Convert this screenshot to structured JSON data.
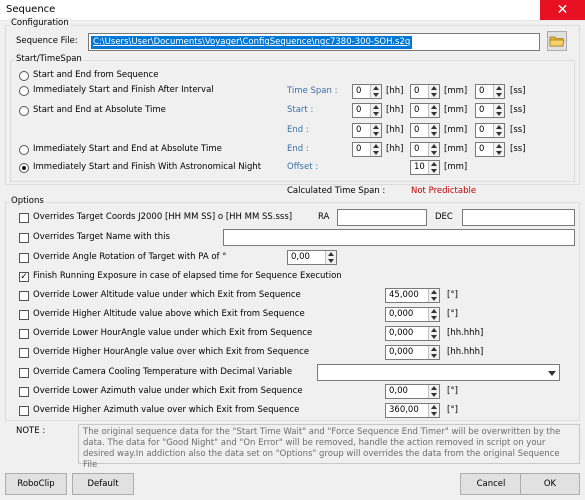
{
  "window": {
    "title": "Sequence",
    "close_symbol": "✕"
  },
  "configuration": {
    "group_label": "Configuration",
    "sequence_file_label": "Sequence File:",
    "sequence_file_value": "C:\\Users\\User\\Documents\\Voyager\\ConfigSequence\\ngc7380-300-SOH.s2q"
  },
  "timespan": {
    "group_label": "Start/TimeSpan",
    "options": [
      "Start and End from Sequence",
      "Immediately Start and Finish After Interval",
      "Start and End at Absolute Time",
      "Immediately Start and End at Absolute Time",
      "Immediately Start and Finish With Astronomical Night"
    ],
    "selected_index": 4,
    "labels": {
      "time_span": "Time Span :",
      "start": "Start :",
      "end1": "End :",
      "end2": "End :",
      "offset": "Offset :"
    },
    "units": {
      "hh": "[hh]",
      "mm": "[mm]",
      "ss": "[ss]"
    },
    "rows": {
      "time_span": [
        "0",
        "0",
        "0"
      ],
      "start": [
        "0",
        "0",
        "0"
      ],
      "end1": [
        "0",
        "0",
        "0"
      ],
      "end2": [
        "0",
        "0",
        "0"
      ]
    },
    "offset_value": "10",
    "offset_unit": "[mm]",
    "calc_label": "Calculated Time Span :",
    "calc_value": "Not Predictable"
  },
  "options": {
    "group_label": "Options",
    "target_coords_label": "Overrides Target Coords J2000  [HH MM SS] o [HH MM SS.sss]",
    "ra_label": "RA",
    "ra_value": "",
    "dec_label": "DEC",
    "dec_value": "",
    "target_name_label": "Overrides Target Name with this",
    "target_name_value": "",
    "pa_label": "Override Angle Rotation of Target with PA of °",
    "pa_value": "0,00",
    "finish_exposure_label": "Finish Running Exposure in case of elapsed time for Sequence Execution",
    "finish_exposure_checked": true,
    "lower_alt_label": "Override Lower Altitude value under which Exit from Sequence",
    "lower_alt_value": "45,000",
    "higher_alt_label": "Override Higher Altitude value above which Exit from Sequence",
    "higher_alt_value": "0,000",
    "lower_ha_label": "Override Lower HourAngle value under which Exit from Sequence",
    "lower_ha_value": "0,000",
    "higher_ha_label": "Override Higher HourAngle value over which Exit from Sequence",
    "higher_ha_value": "0,000",
    "deg_unit": "[°]",
    "hh_unit": "[hh.hhh]",
    "cooling_label": "Override Camera Cooling Temperature with Decimal Variable",
    "cooling_value": "",
    "lower_az_label": "Override Lower Azimuth value under which Exit from Sequence",
    "lower_az_value": "0,00",
    "higher_az_label": "Override Higher Azimuth value over which Exit from Sequence",
    "higher_az_value": "360,00"
  },
  "note": {
    "label": "NOTE :",
    "text": "The original sequence data for the \"Start Time Wait\" and \"Force Sequence End Timer\" will be overwritten by the data. The data for \"Good Night\" and \"On Error\" will be removed, handle the action removed in script on your desired way.In addiction also the data set on \"Options\" group will overrides the data from the original Sequence File"
  },
  "buttons": {
    "roboclip": "RoboClip",
    "default": "Default",
    "cancel": "Cancel",
    "ok": "OK"
  },
  "colors": {
    "accent_blue": "#3b6ea8",
    "warning_red": "#c00000",
    "selection": "#0078d7",
    "close_red": "#e81123"
  }
}
